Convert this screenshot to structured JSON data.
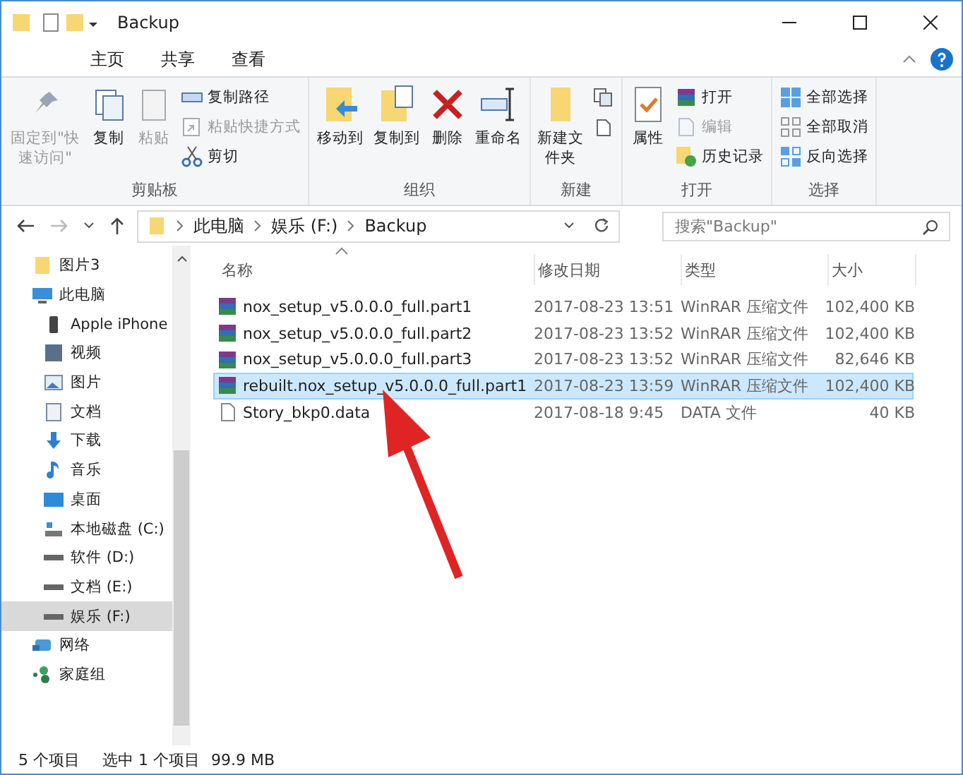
{
  "window": {
    "title": "Backup"
  },
  "tabs": [
    {
      "label": "主页"
    },
    {
      "label": "共享"
    },
    {
      "label": "查看"
    }
  ],
  "ribbon": [
    {
      "label": "剪贴板",
      "large": [
        {
          "label": "固定到\"快速访问\"",
          "kind": "pin",
          "disabled": true
        },
        {
          "label": "复制",
          "kind": "copy",
          "disabled": false
        },
        {
          "label": "粘贴",
          "kind": "paste",
          "disabled": true
        }
      ],
      "small": [
        {
          "label": "复制路径",
          "kind": "path",
          "disabled": false
        },
        {
          "label": "粘贴快捷方式",
          "kind": "shortcut",
          "disabled": true
        },
        {
          "label": "剪切",
          "kind": "cut",
          "disabled": false
        }
      ]
    },
    {
      "label": "组织",
      "large": [
        {
          "label": "移动到",
          "kind": "move",
          "disabled": false
        },
        {
          "label": "复制到",
          "kind": "copyto",
          "disabled": false
        },
        {
          "label": "删除",
          "kind": "delete",
          "disabled": false
        },
        {
          "label": "重命名",
          "kind": "rename",
          "disabled": false
        }
      ]
    },
    {
      "label": "新建",
      "large": [
        {
          "label": "新建文件夹",
          "kind": "folder",
          "disabled": false
        }
      ],
      "small": [
        {
          "kind": "newitem"
        },
        {
          "kind": "easyaccess"
        }
      ]
    },
    {
      "label": "打开",
      "large": [
        {
          "label": "属性",
          "kind": "properties",
          "disabled": false
        }
      ],
      "small": [
        {
          "label": "打开",
          "kind": "open",
          "disabled": false
        },
        {
          "label": "编辑",
          "kind": "edit",
          "disabled": true
        },
        {
          "label": "历史记录",
          "kind": "history",
          "disabled": false
        }
      ]
    },
    {
      "label": "选择",
      "small": [
        {
          "label": "全部选择",
          "kind": "selectall",
          "disabled": false
        },
        {
          "label": "全部取消",
          "kind": "selectnone",
          "disabled": false
        },
        {
          "label": "反向选择",
          "kind": "invert",
          "disabled": false
        }
      ]
    }
  ],
  "address": {
    "crumbs": [
      "此电脑",
      "娱乐 (F:)",
      "Backup"
    ],
    "search_placeholder": "搜索\"Backup\""
  },
  "nav": [
    {
      "label": "图片3",
      "kind": "folder",
      "selected": false
    },
    {
      "label": "此电脑",
      "kind": "pc",
      "selected": false,
      "children": [
        {
          "label": "Apple iPhone",
          "kind": "phone",
          "selected": false
        },
        {
          "label": "视频",
          "kind": "video",
          "selected": false
        },
        {
          "label": "图片",
          "kind": "pictures",
          "selected": false
        },
        {
          "label": "文档",
          "kind": "docs",
          "selected": false
        },
        {
          "label": "下载",
          "kind": "download",
          "selected": false
        },
        {
          "label": "音乐",
          "kind": "music",
          "selected": false
        },
        {
          "label": "桌面",
          "kind": "desktop",
          "selected": false
        },
        {
          "label": "本地磁盘 (C:)",
          "kind": "sysdrive",
          "selected": false
        },
        {
          "label": "软件 (D:)",
          "kind": "drive",
          "selected": false
        },
        {
          "label": "文档 (E:)",
          "kind": "drive",
          "selected": false
        },
        {
          "label": "娱乐 (F:)",
          "kind": "drive",
          "selected": true
        }
      ]
    },
    {
      "label": "网络",
      "kind": "network",
      "selected": false
    },
    {
      "label": "家庭组",
      "kind": "homegroup",
      "selected": false
    }
  ],
  "table": {
    "columns": [
      "名称",
      "修改日期",
      "类型",
      "大小"
    ],
    "rows": [
      {
        "name": "nox_setup_v5.0.0.0_full.part1",
        "date": "2017-08-23 13:51",
        "type": "WinRAR 压缩文件",
        "size": "102,400 KB",
        "kind": "rar",
        "selected": false
      },
      {
        "name": "nox_setup_v5.0.0.0_full.part2",
        "date": "2017-08-23 13:52",
        "type": "WinRAR 压缩文件",
        "size": "102,400 KB",
        "kind": "rar",
        "selected": false
      },
      {
        "name": "nox_setup_v5.0.0.0_full.part3",
        "date": "2017-08-23 13:52",
        "type": "WinRAR 压缩文件",
        "size": "82,646 KB",
        "kind": "rar",
        "selected": false
      },
      {
        "name": "rebuilt.nox_setup_v5.0.0.0_full.part1",
        "date": "2017-08-23 13:59",
        "type": "WinRAR 压缩文件",
        "size": "102,400 KB",
        "kind": "rar",
        "selected": true
      },
      {
        "name": "Story_bkp0.data",
        "date": "2017-08-18 9:45",
        "type": "DATA 文件",
        "size": "40 KB",
        "kind": "data",
        "selected": false
      }
    ]
  },
  "status_bar": {
    "count": "5 个项目",
    "selection": "选中 1 个项目",
    "size": "99.9 MB"
  }
}
